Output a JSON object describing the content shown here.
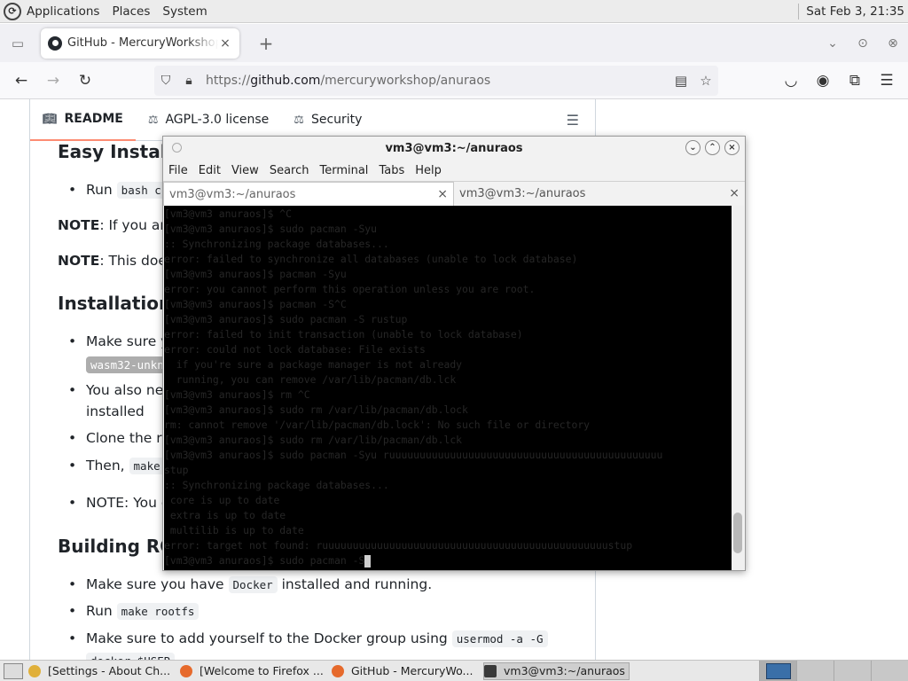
{
  "top_panel": {
    "menus": [
      "Applications",
      "Places",
      "System"
    ],
    "clock": "Sat Feb  3, 21:35"
  },
  "browser": {
    "tab": {
      "title": "GitHub - MercuryWorkshop/anuraos",
      "close": "×"
    },
    "new_tab": "+",
    "url": {
      "scheme": "https://",
      "host": "github.com",
      "path": "/mercuryworkshop/anuraos"
    }
  },
  "readme": {
    "tabs": [
      {
        "label": "README",
        "icon": "book-icon"
      },
      {
        "label": "AGPL-3.0 license",
        "icon": "scale-icon"
      },
      {
        "label": "Security",
        "icon": "scale-icon"
      }
    ],
    "easy_install_heading": "Easy Install",
    "run_bash_prefix": "Run",
    "run_bash_code": "bash c",
    "note1_bold": "NOTE",
    "note1_text": ": If you are",
    "note2_bold": "NOTE",
    "note2_text": ": This does",
    "installation_heading": "Installation",
    "make_sure_prefix": "Make sure y",
    "wasm_code": "wasm32-unkn",
    "also_need": "You also nee",
    "installed": "installed",
    "clone": "Clone the re",
    "then_prefix": "Then,",
    "then_code": "make",
    "note3": "NOTE: You c",
    "building_heading": "Building RO",
    "docker_prefix": "Make sure you have",
    "docker_code": "Docker",
    "docker_suffix": "installed and running.",
    "run_prefix": "Run",
    "rootfs_code": "make rootfs",
    "usermod_prefix": "Make sure to add yourself to the Docker group using",
    "usermod_code": "usermod -a -G",
    "cut_code": "docker $USER"
  },
  "terminal": {
    "title": "vm3@vm3:~/anuraos",
    "menus": [
      "File",
      "Edit",
      "View",
      "Search",
      "Terminal",
      "Tabs",
      "Help"
    ],
    "tabs": [
      "vm3@vm3:~/anuraos",
      "vm3@vm3:~/anuraos"
    ],
    "lines": [
      "[vm3@vm3 anuraos]$ ^C",
      "[vm3@vm3 anuraos]$ sudo pacman -Syu",
      ":: Synchronizing package databases...",
      "error: failed to synchronize all databases (unable to lock database)",
      "[vm3@vm3 anuraos]$ pacman -Syu",
      "error: you cannot perform this operation unless you are root.",
      "[vm3@vm3 anuraos]$ pacman -S^C",
      "[vm3@vm3 anuraos]$ sudo pacman -S rustup",
      "error: failed to init transaction (unable to lock database)",
      "error: could not lock database: File exists",
      "  if you're sure a package manager is not already",
      "  running, you can remove /var/lib/pacman/db.lck",
      "[vm3@vm3 anuraos]$ rm ^C",
      "[vm3@vm3 anuraos]$ sudo rm /var/lib/pacman/db.lock",
      "rm: cannot remove '/var/lib/pacman/db.lock': No such file or directory",
      "[vm3@vm3 anuraos]$ sudo rm /var/lib/pacman/db.lck",
      "[vm3@vm3 anuraos]$ sudo pacman -Syu ruuuuuuuuuuuuuuuuuuuuuuuuuuuuuuuuuuuuuuuuuuuuu",
      "stup",
      ":: Synchronizing package databases...",
      " core is up to date",
      " extra is up to date",
      " multilib is up to date",
      "error: target not found: ruuuuuuuuuuuuuuuuuuuuuuuuuuuuuuuuuuuuuuuuuuuuuuustup",
      "[vm3@vm3 anuraos]$ sudo pacman -S"
    ]
  },
  "taskbar": {
    "tasks": [
      {
        "label": "[Settings - About Ch...",
        "icon_color": "#e0b03a"
      },
      {
        "label": "[Welcome to Firefox ...",
        "icon_color": "#e66a2c"
      },
      {
        "label": "GitHub - MercuryWo...",
        "icon_color": "#e66a2c"
      },
      {
        "label": "vm3@vm3:~/anuraos",
        "icon_color": "#3a3a3a"
      }
    ]
  }
}
